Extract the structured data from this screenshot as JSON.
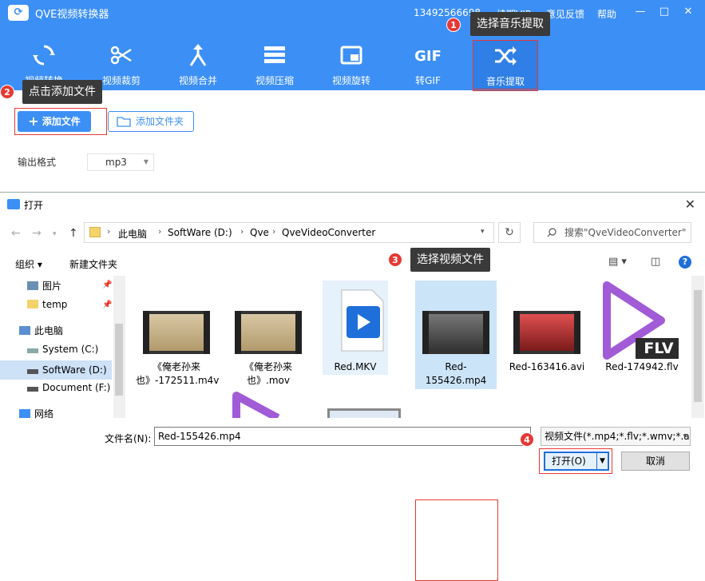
{
  "app": {
    "title": "QVE视频转换器",
    "phone": "13492566698",
    "renew": "续期VIP",
    "feedback": "意见反馈",
    "help": "帮助",
    "window_controls": [
      "minimize-icon",
      "restore-icon",
      "close-icon"
    ],
    "tools": [
      {
        "label": "视频转换",
        "icon": "convert-icon"
      },
      {
        "label": "视频裁剪",
        "icon": "scissors-icon"
      },
      {
        "label": "视频合并",
        "icon": "merge-icon"
      },
      {
        "label": "视频压缩",
        "icon": "compress-icon"
      },
      {
        "label": "视频旋转",
        "icon": "rotate-icon"
      },
      {
        "label": "转GIF",
        "icon": "gif-icon",
        "icon_text": "GIF"
      },
      {
        "label": "音乐提取",
        "icon": "shuffle-icon",
        "active": true
      }
    ],
    "add_file": "添加文件",
    "add_folder": "添加文件夹",
    "output_label": "输出格式",
    "output_value": "mp3",
    "accent": "#3c8ff5"
  },
  "callouts": [
    {
      "num": "1",
      "text": "选择音乐提取"
    },
    {
      "num": "2",
      "text": "点击添加文件"
    },
    {
      "num": "3",
      "text": "选择视频文件"
    },
    {
      "num": "4",
      "text": ""
    }
  ],
  "dialog": {
    "title": "打开",
    "address": [
      "此电脑",
      "SoftWare (D:)",
      "Qve",
      "QveVideoConverter"
    ],
    "search_placeholder": "搜索\"QveVideoConverter\"",
    "organize": "组织 ▾",
    "new_folder": "新建文件夹",
    "tree": [
      {
        "label": "图片",
        "icon": "pictures-icon",
        "pinned": true
      },
      {
        "label": "temp",
        "icon": "folder-icon",
        "pinned": true
      },
      {
        "label": "此电脑",
        "icon": "computer-icon"
      },
      {
        "label": "System (C:)",
        "icon": "drive-icon"
      },
      {
        "label": "SoftWare (D:)",
        "icon": "drive-icon",
        "selected": true
      },
      {
        "label": "Document (F:)",
        "icon": "drive-icon"
      },
      {
        "label": "网络",
        "icon": "network-icon"
      }
    ],
    "files": [
      {
        "name": "《俺老孙来也》-172511.m4v",
        "type": "video-thumb"
      },
      {
        "name": "《俺老孙来也》.mov",
        "type": "video-thumb"
      },
      {
        "name": "Red.MKV",
        "type": "mkv-icon"
      },
      {
        "name": "Red-155426.mp4",
        "type": "video-thumb",
        "selected": true
      },
      {
        "name": "Red-163416.avi",
        "type": "video-thumb"
      },
      {
        "name": "Red-174942.flv",
        "type": "flv-icon",
        "badge": "FLV"
      }
    ],
    "filename_label": "文件名(N):",
    "filename_value": "Red-155426.mp4",
    "filetype_value": "视频文件(*.mp4;*.flv;*.wmv;*.a",
    "open_label": "打开(O)",
    "cancel_label": "取消"
  }
}
